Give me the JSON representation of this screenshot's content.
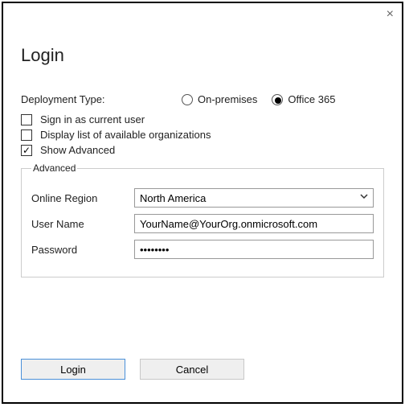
{
  "title": "Login",
  "close_glyph": "×",
  "deployment": {
    "label": "Deployment Type:",
    "options": {
      "onprem": "On-premises",
      "o365": "Office 365"
    },
    "selected": "o365"
  },
  "checks": {
    "sign_in_current": {
      "label": "Sign in as current user",
      "checked": false
    },
    "display_orgs": {
      "label": "Display list of available organizations",
      "checked": false
    },
    "show_advanced": {
      "label": "Show Advanced",
      "checked": true
    }
  },
  "advanced": {
    "legend": "Advanced",
    "region": {
      "label": "Online Region",
      "value": "North America"
    },
    "username": {
      "label": "User Name",
      "value": "YourName@YourOrg.onmicrosoft.com"
    },
    "password": {
      "label": "Password",
      "value": "••••••••"
    }
  },
  "buttons": {
    "login": "Login",
    "cancel": "Cancel"
  }
}
